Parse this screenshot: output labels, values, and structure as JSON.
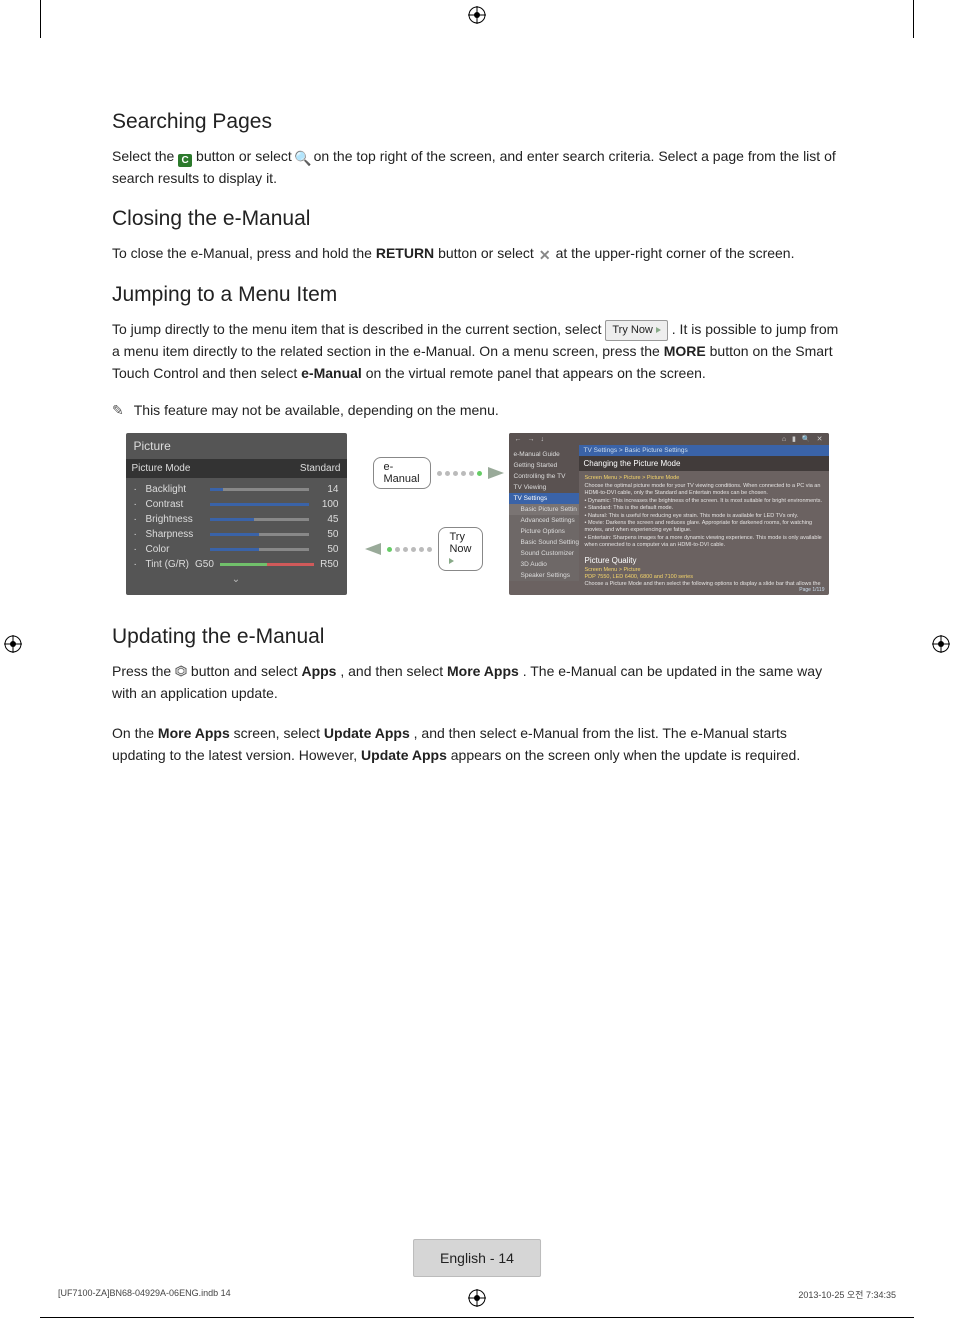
{
  "sections": {
    "search": {
      "heading": "Searching Pages",
      "p_a": "Select the ",
      "p_b": " button or select ",
      "p_c": " on the top right of the screen, and enter search criteria. Select a page from the list of search results to display it."
    },
    "close": {
      "heading": "Closing the e-Manual",
      "p_a": "To close the e-Manual, press and hold the ",
      "return_label": "RETURN",
      "p_b": " button or select ",
      "p_c": " at the upper-right corner of the screen."
    },
    "jump": {
      "heading": "Jumping to a Menu Item",
      "p1_a": "To jump directly to the menu item that is described in the current section, select ",
      "p1_b": ". It is possible to jump from a menu item directly to the related section in the e-Manual. On a menu screen, press the ",
      "more_label": "MORE",
      "p1_c": " button on the Smart Touch Control and then select ",
      "emanual_label": "e-Manual",
      "p1_d": " on the virtual remote panel that appears on the screen.",
      "note": "This feature may not be available, depending on the menu."
    },
    "update": {
      "heading": "Updating the e-Manual",
      "p1_a": "Press the ",
      "p1_b": " button and select ",
      "apps_label": "Apps",
      "p1_c": ", and then select ",
      "more_apps_label": "More Apps",
      "p1_d": ". The e-Manual can be updated in the same way with an application update.",
      "p2_a": "On the ",
      "p2_b": " screen, select ",
      "update_apps_label": "Update Apps",
      "p2_c": ", and then select e-Manual from the list. The e-Manual starts updating to the latest version. However, ",
      "p2_d": " appears on the screen only when the update is required."
    }
  },
  "trynow_label": "Try Now",
  "icons": {
    "c_button": "C",
    "magnifier": "🔍",
    "close": "✕",
    "smarthub": "⬡"
  },
  "tvpanel": {
    "title": "Picture",
    "mode_label": "Picture Mode",
    "mode_value": "Standard",
    "rows": {
      "backlight": {
        "lbl": "Backlight",
        "val": "14"
      },
      "contrast": {
        "lbl": "Contrast",
        "val": "100"
      },
      "bright": {
        "lbl": "Brightness",
        "val": "45"
      },
      "sharp": {
        "lbl": "Sharpness",
        "val": "50"
      },
      "color": {
        "lbl": "Color",
        "val": "50"
      }
    },
    "tint": {
      "lbl": "Tint (G/R)",
      "g": "G50",
      "r": "R50"
    }
  },
  "connect": {
    "emanual_pill": "e-Manual",
    "trynow_pill": "Try Now"
  },
  "manual": {
    "side": [
      "e-Manual Guide",
      "Getting Started",
      "Controlling the TV",
      "TV Viewing",
      "TV Settings",
      "Basic Picture Settings",
      "Advanced Settings",
      "Picture Options",
      "Basic Sound Settings",
      "Sound Customizer",
      "3D Audio",
      "Speaker Settings"
    ],
    "breadcrumb": "TV Settings > Basic Picture Settings",
    "h1": "Changing the Picture Mode",
    "body1": "Screen Menu > Picture > Picture Mode",
    "body2": "Choose the optimal picture mode for your TV viewing conditions. When connected to a PC via an HDMI-to-DVI cable, only the Standard and Entertain modes can be chosen.",
    "bul1": "Dynamic: This increases the brightness of the screen. It is most suitable for bright environments.",
    "bul2": "Standard: This is the default mode.",
    "bul3": "Natural: This is useful for reducing eye strain. This mode is available for LED TVs only.",
    "bul4": "Movie: Darkens the screen and reduces glare. Appropriate for darkened rooms, for watching movies, and when experiencing eye fatigue.",
    "bul5": "Entertain: Sharpens images for a more dynamic viewing experience. This mode is only available when connected to a computer via an HDMI-to-DVI cable.",
    "h2": "Picture Quality",
    "body3": "Screen Menu > Picture",
    "body_hl": "PDP 7550, LED 6400, 6800 and 7100 series",
    "body4": "Choose a Picture Mode and then select the following options to display a slide bar that allows the",
    "foot": "Page 1/119"
  },
  "footer": {
    "badge": "English - 14",
    "left": "[UF7100-ZA]BN68-04929A-06ENG.indb   14",
    "right": "2013-10-25   오전 7:34:35"
  }
}
